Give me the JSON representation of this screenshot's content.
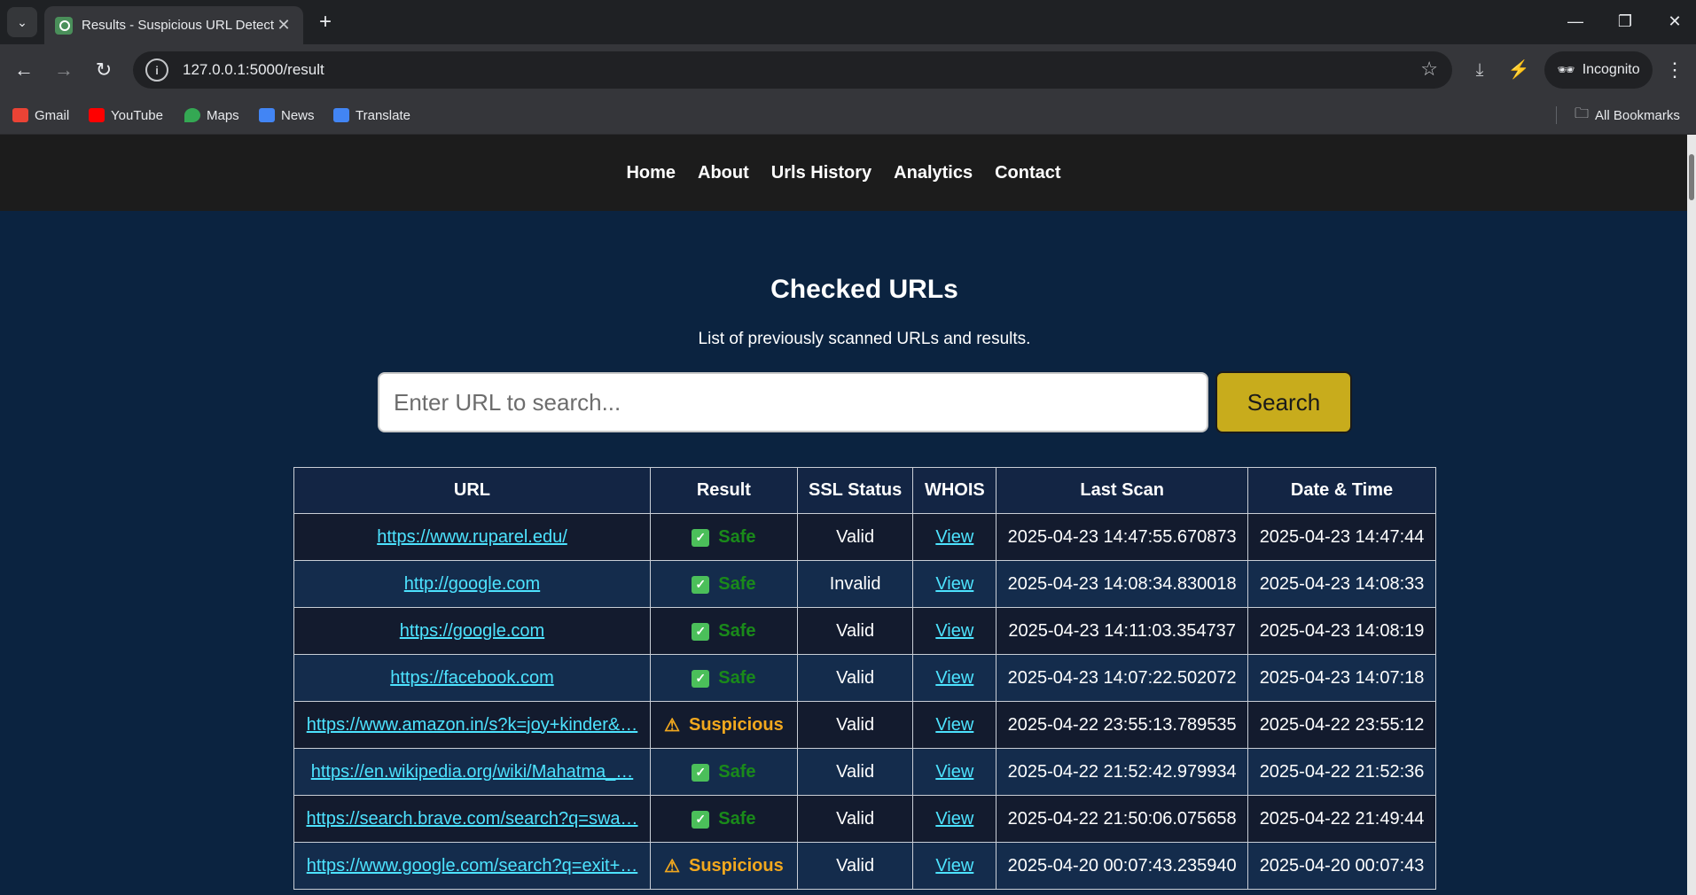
{
  "browser": {
    "tab_title": "Results - Suspicious URL Detect",
    "url": "127.0.0.1:5000/result",
    "incognito_label": "Incognito",
    "bookmarks": [
      "Gmail",
      "YouTube",
      "Maps",
      "News",
      "Translate"
    ],
    "all_bookmarks": "All Bookmarks"
  },
  "nav": {
    "items": [
      "Home",
      "About",
      "Urls History",
      "Analytics",
      "Contact"
    ]
  },
  "header": {
    "title": "Checked URLs",
    "subtitle": "List of previously scanned URLs and results."
  },
  "search": {
    "placeholder": "Enter URL to search...",
    "button": "Search"
  },
  "table": {
    "columns": [
      "URL",
      "Result",
      "SSL Status",
      "WHOIS",
      "Last Scan",
      "Date & Time"
    ],
    "rows": [
      {
        "url": "https://www.ruparel.edu/",
        "result": "Safe",
        "ssl": "Valid",
        "whois": "View",
        "last_scan": "2025-04-23 14:47:55.670873",
        "datetime": "2025-04-23 14:47:44"
      },
      {
        "url": "http://google.com",
        "result": "Safe",
        "ssl": "Invalid",
        "whois": "View",
        "last_scan": "2025-04-23 14:08:34.830018",
        "datetime": "2025-04-23 14:08:33"
      },
      {
        "url": "https://google.com",
        "result": "Safe",
        "ssl": "Valid",
        "whois": "View",
        "last_scan": "2025-04-23 14:11:03.354737",
        "datetime": "2025-04-23 14:08:19"
      },
      {
        "url": "https://facebook.com",
        "result": "Safe",
        "ssl": "Valid",
        "whois": "View",
        "last_scan": "2025-04-23 14:07:22.502072",
        "datetime": "2025-04-23 14:07:18"
      },
      {
        "url": "https://www.amazon.in/s?k=joy+kinder&…",
        "result": "Suspicious",
        "ssl": "Valid",
        "whois": "View",
        "last_scan": "2025-04-22 23:55:13.789535",
        "datetime": "2025-04-22 23:55:12"
      },
      {
        "url": "https://en.wikipedia.org/wiki/Mahatma_…",
        "result": "Safe",
        "ssl": "Valid",
        "whois": "View",
        "last_scan": "2025-04-22 21:52:42.979934",
        "datetime": "2025-04-22 21:52:36"
      },
      {
        "url": "https://search.brave.com/search?q=swa…",
        "result": "Safe",
        "ssl": "Valid",
        "whois": "View",
        "last_scan": "2025-04-22 21:50:06.075658",
        "datetime": "2025-04-22 21:49:44"
      },
      {
        "url": "https://www.google.com/search?q=exit+…",
        "result": "Suspicious",
        "ssl": "Valid",
        "whois": "View",
        "last_scan": "2025-04-20 00:07:43.235940",
        "datetime": "2025-04-20 00:07:43"
      }
    ]
  },
  "colors": {
    "accent": "#c8ac1c",
    "link": "#4de3ff",
    "safe": "#1a8a1a",
    "suspicious": "#f2a81e",
    "background": "#0b2340"
  }
}
